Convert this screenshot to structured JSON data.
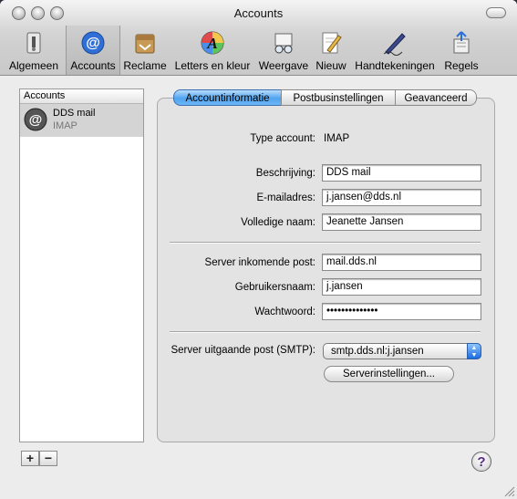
{
  "window": {
    "title": "Accounts"
  },
  "toolbar": {
    "items": [
      {
        "label": "Algemeen",
        "icon": "general-switch-icon"
      },
      {
        "label": "Accounts",
        "icon": "at-sign-icon"
      },
      {
        "label": "Reclame",
        "icon": "junk-mail-icon"
      },
      {
        "label": "Letters en kleur",
        "icon": "fonts-colors-icon"
      },
      {
        "label": "Weergave",
        "icon": "viewing-glasses-icon"
      },
      {
        "label": "Nieuw",
        "icon": "composing-pencil-icon"
      },
      {
        "label": "Handtekeningen",
        "icon": "signature-pen-icon"
      },
      {
        "label": "Regels",
        "icon": "rules-arrows-icon"
      }
    ],
    "selected": "Accounts"
  },
  "sidebar": {
    "header": "Accounts",
    "accounts": [
      {
        "name": "DDS mail",
        "type": "IMAP",
        "icon": "at-sign-icon"
      }
    ]
  },
  "tabs": [
    "Accountinformatie",
    "Postbusinstellingen",
    "Geavanceerd"
  ],
  "form": {
    "type_label": "Type account:",
    "type_value": "IMAP",
    "description_label": "Beschrijving:",
    "description_value": "DDS mail",
    "email_label": "E-mailadres:",
    "email_value": "j.jansen@dds.nl",
    "fullname_label": "Volledige naam:",
    "fullname_value": "Jeanette Jansen",
    "incoming_label": "Server inkomende post:",
    "incoming_value": "mail.dds.nl",
    "username_label": "Gebruikersnaam:",
    "username_value": "j.jansen",
    "password_label": "Wachtwoord:",
    "password_value": "••••••••••••••",
    "smtp_label": "Server uitgaande post (SMTP):",
    "smtp_value": "smtp.dds.nl:j.jansen",
    "server_settings_button": "Serverinstellingen..."
  },
  "bottom": {
    "add": "+",
    "remove": "−",
    "help": "?"
  },
  "colors": {
    "accent": "#4fa3ef",
    "window_bg": "#ececec"
  }
}
